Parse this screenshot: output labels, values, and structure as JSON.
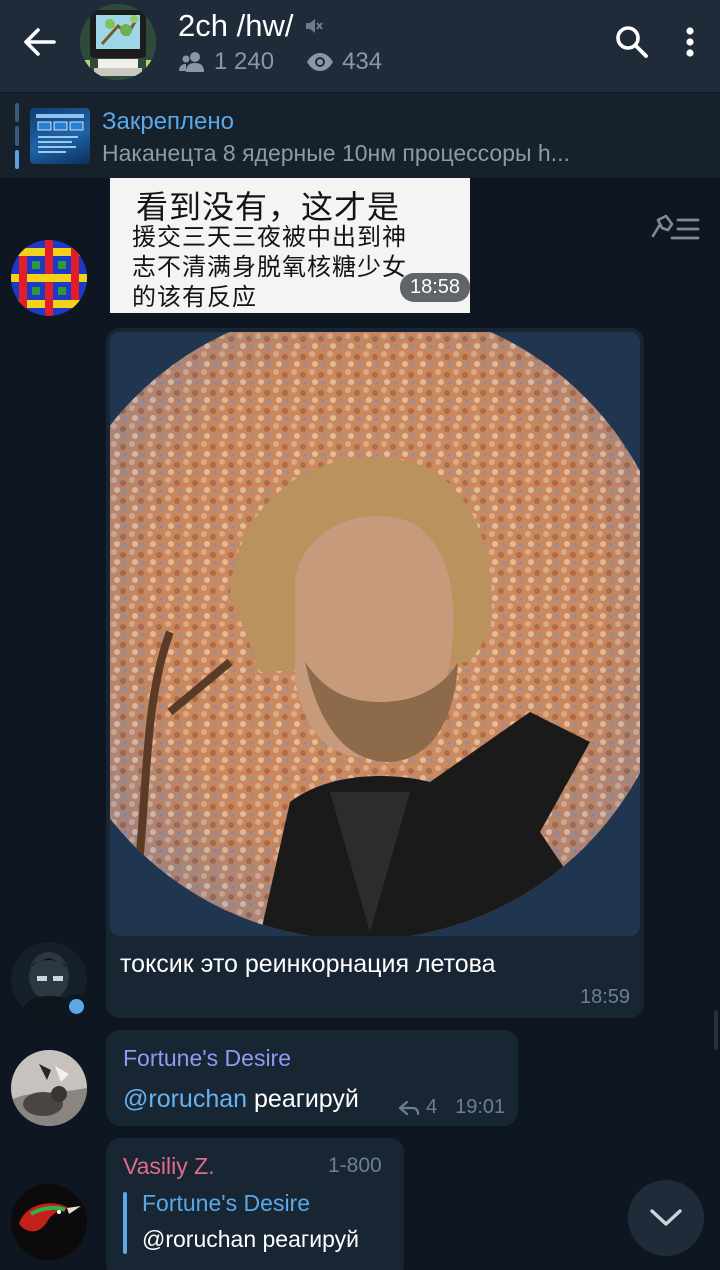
{
  "header": {
    "title": "2ch /hw/",
    "members": "1 240",
    "online": "434",
    "muted_icon": "speaker-muted-icon"
  },
  "pinned": {
    "label": "Закреплено",
    "text": "Наканецта 8 ядерные 10нм процессоры h..."
  },
  "messages": [
    {
      "type": "image",
      "image_text": [
        "看到没有，这才是",
        "援交三天三夜被中出到神",
        "志不清满身脱氧核糖少女",
        "的该有反应"
      ],
      "time": "18:58"
    },
    {
      "type": "photo",
      "text": "токсик это реинкорнация летова",
      "time": "18:59"
    },
    {
      "type": "text",
      "sender": "Fortune's Desire",
      "mention": "@roruchan",
      "text": "реагируй",
      "replies": "4",
      "time": "19:01"
    },
    {
      "type": "reply",
      "sender": "Vasiliy Z.",
      "sender_tag": "1-800",
      "quote_sender": "Fortune's Desire",
      "quote_text": "@roruchan реагируй"
    }
  ],
  "colors": {
    "accent": "#5aa8e8",
    "background": "#0e1621",
    "bubble": "#182533",
    "header": "#1f2b38",
    "sender_fortune": "#8e9bf2",
    "sender_vasiliy": "#e06b8d"
  }
}
